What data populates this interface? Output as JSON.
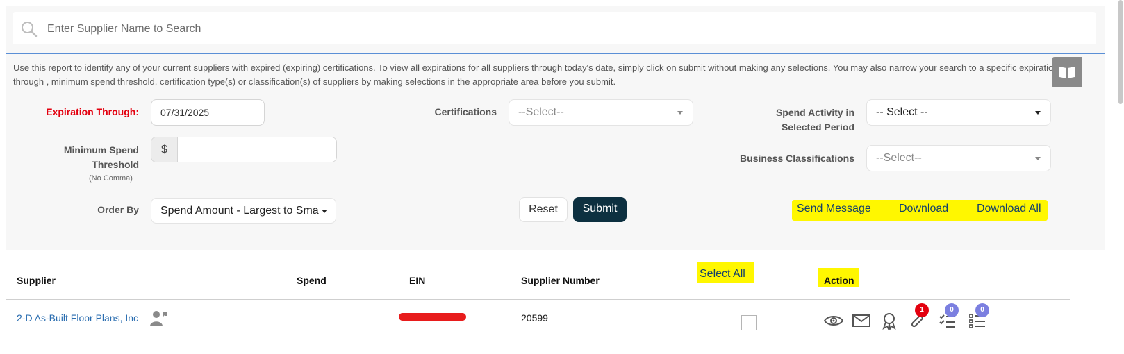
{
  "search": {
    "placeholder": "Enter Supplier Name to Search"
  },
  "description": "Use this report to identify any of your current suppliers with expired (expiring) certifications. To view all expirations for all suppliers through today's date, simply click on submit without making any selections. You may also narrow your search to a specific expiration through , minimum spend threshold, certification type(s) or classification(s) of suppliers by making selections in the appropriate area before you submit.",
  "filters": {
    "expiration_label": "Expiration Through:",
    "expiration_value": "07/31/2025",
    "min_spend_label_1": "Minimum Spend",
    "min_spend_label_2": "Threshold",
    "min_spend_note": "(No Comma)",
    "currency_symbol": "$",
    "order_by_label": "Order By",
    "order_by_value": "Spend Amount - Largest to Sma",
    "certifications_label": "Certifications",
    "certifications_value": "--Select--",
    "spend_activity_label_1": "Spend Activity in",
    "spend_activity_label_2": "Selected Period",
    "spend_activity_value": "-- Select --",
    "business_class_label": "Business Classifications",
    "business_class_value": "--Select--"
  },
  "buttons": {
    "reset": "Reset",
    "submit": "Submit",
    "send_message": "Send Message",
    "download": "Download",
    "download_all": "Download All"
  },
  "table": {
    "headers": {
      "supplier": "Supplier",
      "spend": "Spend",
      "ein": "EIN",
      "supplier_number": "Supplier Number",
      "select_all": "Select All",
      "action": "Action"
    },
    "rows": [
      {
        "supplier": "2-D As-Built Floor Plans, Inc",
        "spend": "",
        "supplier_number": "20599",
        "attachments_count": "1",
        "checklist_count": "0",
        "list_count": "0"
      }
    ]
  },
  "colors": {
    "accent": "#0d3040",
    "link": "#2a6db0",
    "highlight": "#fff700",
    "required": "#e3000f",
    "badge_red": "#e3000f",
    "badge_purple": "#7b7fe0"
  }
}
